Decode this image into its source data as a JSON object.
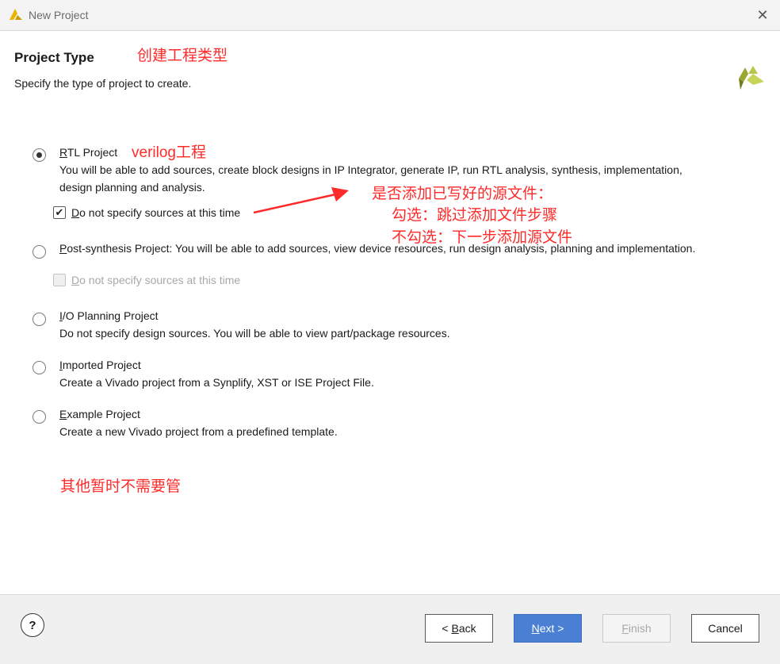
{
  "window": {
    "title": "New Project"
  },
  "header": {
    "title": "Project Type",
    "subtitle": "Specify the type of project to create."
  },
  "options": [
    {
      "label_first": "R",
      "label_rest": "TL Project",
      "desc_lines": [
        "You will be able to add sources, create block designs in IP Integrator, generate IP, run RTL analysis, synthesis, implementation,",
        "design planning and analysis."
      ],
      "selected": true,
      "checkbox": {
        "first": "D",
        "rest": "o not specify sources at this time",
        "checked": true,
        "enabled": true
      }
    },
    {
      "label_first": "P",
      "label_rest": "ost-synthesis Project: You will be able to add sources, view device resources, run design analysis, planning and implementation.",
      "selected": false,
      "checkbox": {
        "first": "D",
        "rest": "o not specify sources at this time",
        "checked": false,
        "enabled": false
      }
    },
    {
      "label_first": "I",
      "label_rest": "/O Planning Project",
      "desc": "Do not specify design sources. You will be able to view part/package resources.",
      "selected": false
    },
    {
      "label_first": "I",
      "label_rest": "mported Project",
      "desc": "Create a Vivado project from a Synplify, XST or ISE Project File.",
      "selected": false
    },
    {
      "label_first": "E",
      "label_rest": "xample Project",
      "desc": "Create a new Vivado project from a predefined template.",
      "selected": false
    }
  ],
  "annotations": {
    "project_type": "创建工程类型",
    "verilog": "verilog工程",
    "question": "是否添加已写好的源文件：",
    "checked": "勾选：跳过添加文件步骤",
    "unchecked": "不勾选：下一步添加源文件",
    "others": "其他暂时不需要管"
  },
  "footer": {
    "help": "?",
    "back_prefix": "< ",
    "back_first": "B",
    "back_rest": "ack",
    "next_first": "N",
    "next_rest": "ext >",
    "finish_first": "F",
    "finish_rest": "inish",
    "cancel": "Cancel"
  },
  "colors": {
    "annotation": "#ff2a2a",
    "primary_button": "#4a7fd4",
    "logo_green": "#8a9a2a"
  }
}
